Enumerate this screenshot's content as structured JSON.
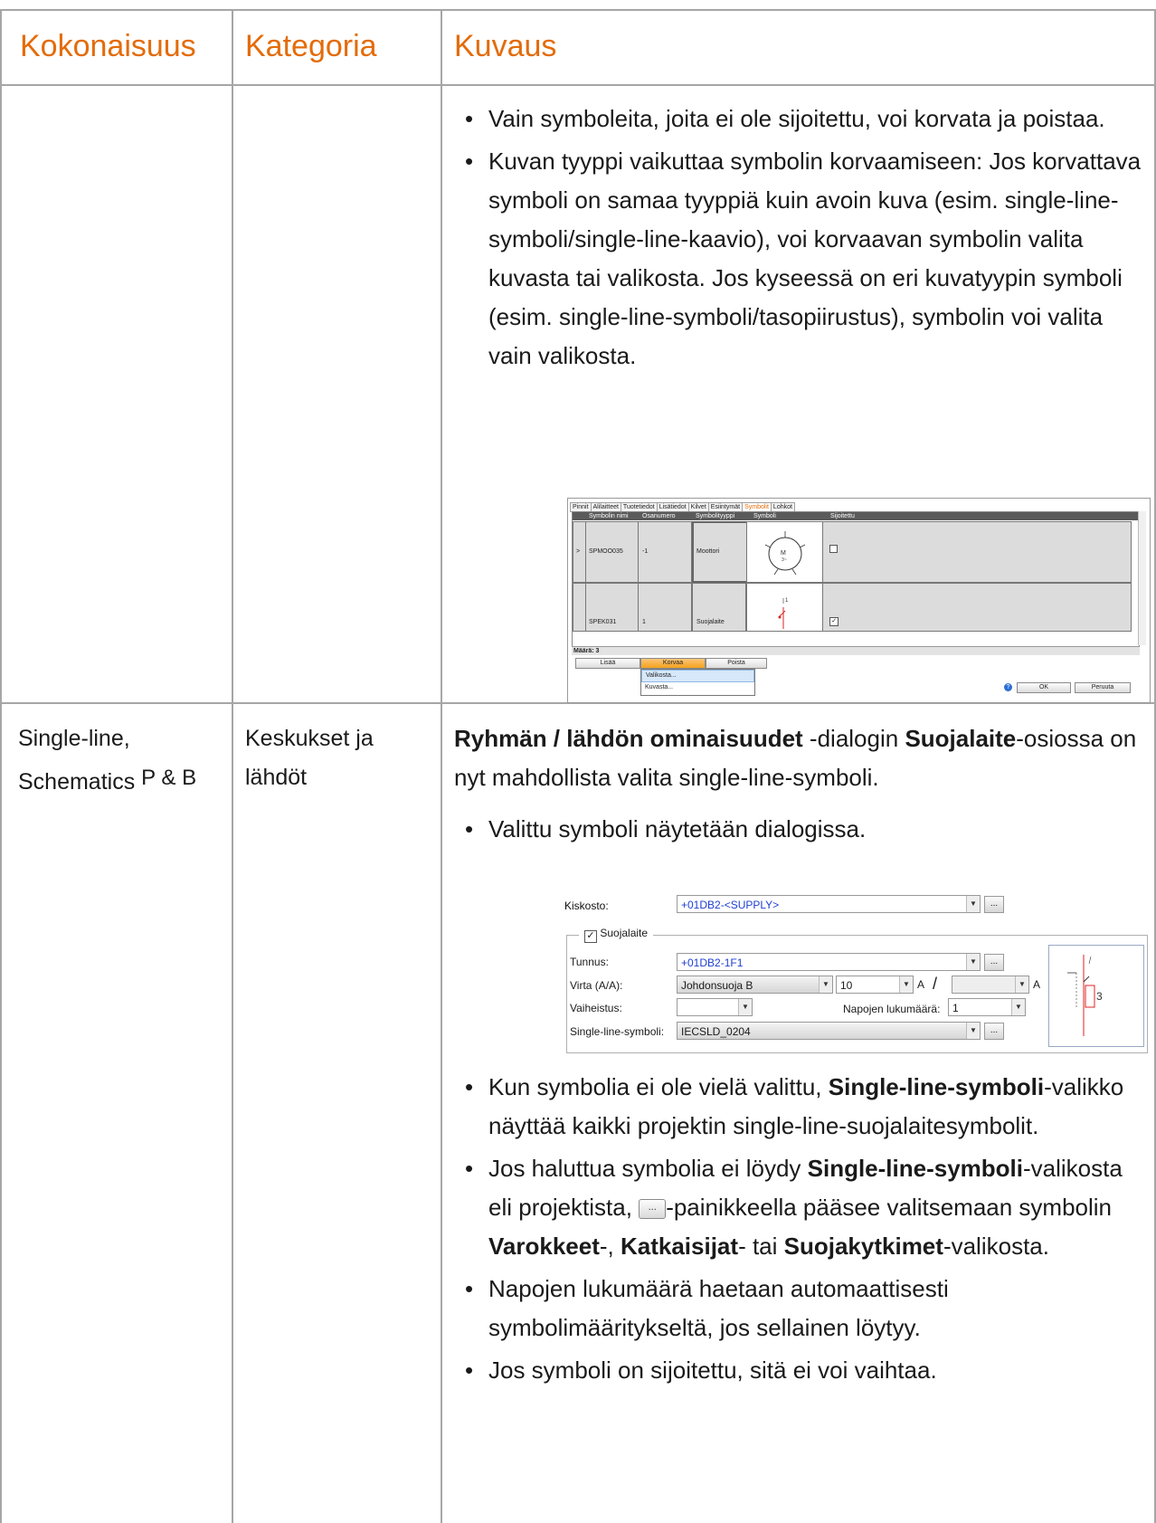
{
  "table": {
    "headers": [
      "Kokonaisuus",
      "Kategoria",
      "Kuvaus"
    ],
    "row1": {
      "bullets": [
        "Vain symboleita, joita ei ole sijoitettu, voi korvata ja poistaa.",
        "Kuvan tyyppi vaikuttaa symbolin korvaamiseen: Jos korvattava symboli on samaa tyyppiä kuin avoin kuva (esim. single-line-symboli/single-line-kaavio), voi korvaavan symbolin valita kuvasta tai valikosta. Jos kyseessä on eri kuvatyypin symboli (esim. single-line-symboli/tasopiirustus), symbolin voi valita vain valikosta."
      ]
    },
    "row2": {
      "kokonaisuus_line1": "Single-line,",
      "kokonaisuus_line2": "Schematics",
      "kokonaisuus_suffix": "P & B",
      "kategoria": "Keskukset ja lähdöt",
      "intro_bold": "Ryhmän / lähdön ominaisuudet",
      "intro_mid": " -dialogin ",
      "intro_bold2": "Suojalaite",
      "intro_rest": "-osiossa on nyt mahdollista valita single-line-symboli.",
      "bullet1": "Valittu symboli näytetään dialogissa.",
      "bullet2_pre": "Kun symbolia ei ole vielä valittu, ",
      "bullet2_bold": "Single-line-symboli",
      "bullet2_post": "-valikko näyttää kaikki projektin single-line-suojalaitesymbolit.",
      "bullet3_pre": "Jos haluttua symbolia ei löydy ",
      "bullet3_bold": "Single-line-symboli",
      "bullet3_mid": "-valikosta eli projektista, ",
      "bullet3_btn": "...",
      "bullet3_mid2": "-painikkeella pääsee valitsemaan symbolin ",
      "bullet3_b1": "Varokkeet",
      "bullet3_s1": "-, ",
      "bullet3_b2": "Katkaisijat",
      "bullet3_s2": "- tai ",
      "bullet3_b3": "Suojakytkimet",
      "bullet3_end": "-valikosta.",
      "bullet4": "Napojen lukumäärä haetaan automaattisesti symbolimääritykseltä, jos sellainen löytyy.",
      "bullet5": "Jos symboli on sijoitettu, sitä ei voi vaihtaa."
    }
  },
  "screenshot1": {
    "tabs": [
      "Pinnit",
      "Alilaitteet",
      "Tuotetiedot",
      "Lisätiedot",
      "Kilvet",
      "Esiintymät",
      "Symbolit",
      "Lohkot"
    ],
    "active_tab": "Symbolit",
    "columns": [
      "Symbolin nimi",
      "Osanumero",
      "Symbolityyppi",
      "Symboli",
      "Sijoitettu"
    ],
    "rows": [
      {
        "marker": ">",
        "name": "SPMOO035",
        "part": "-1",
        "type": "Moottori",
        "placed": ""
      },
      {
        "marker": "",
        "name": "SPEK031",
        "part": "1",
        "type": "Suojalaite",
        "placed": "✓"
      }
    ],
    "count": "Määrä: 3",
    "buttons": {
      "add": "Lisää",
      "replace": "Korvaa",
      "remove": "Poista",
      "ok": "OK",
      "cancel": "Peruuta"
    },
    "dropdown": [
      "Valikosta...",
      "Kuvasta..."
    ],
    "help_icon": "?"
  },
  "screenshot2": {
    "kiskosto_label": "Kiskosto:",
    "kiskosto_value": "+01DB2-<SUPPLY>",
    "group_label": "Suojalaite",
    "tunnus_label": "Tunnus:",
    "tunnus_value": "+01DB2-1F1",
    "virta_label": "Virta (A/A):",
    "virta_type": "Johdonsuoja B",
    "virta_value": "10",
    "unit_a": "A",
    "slash": "/",
    "vaiheistus_label": "Vaiheistus:",
    "napojen_label": "Napojen lukumäärä:",
    "napojen_value": "1",
    "sl_label": "Single-line-symboli:",
    "sl_value": "IECSLD_0204",
    "dots": "...",
    "symbol_number": "3"
  },
  "colors": {
    "header_text": "#e36c0a",
    "grid_line": "#a6a6a6",
    "link_blue": "#1f3fd1"
  }
}
